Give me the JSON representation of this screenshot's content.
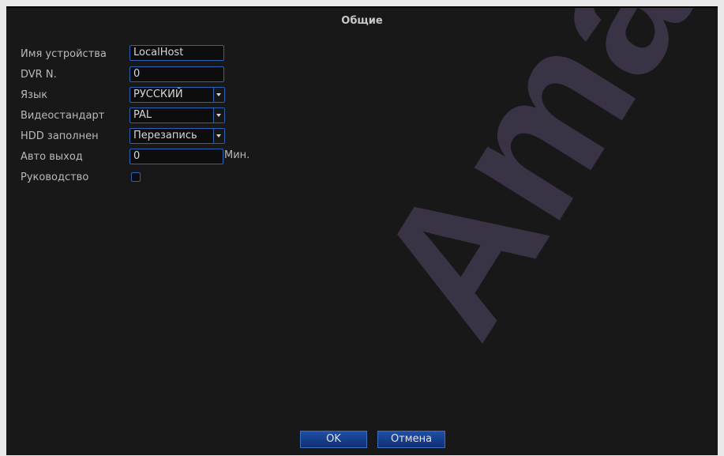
{
  "window": {
    "title": "Общие"
  },
  "form": {
    "device_name": {
      "label": "Имя устройства",
      "value": "LocalHost"
    },
    "dvr_no": {
      "label": "DVR N.",
      "value": "0"
    },
    "language": {
      "label": "Язык",
      "value": "РУССКИЙ"
    },
    "video_standard": {
      "label": "Видеостандарт",
      "value": "PAL"
    },
    "hdd_full": {
      "label": "HDD заполнен",
      "value": "Перезапись"
    },
    "auto_logout": {
      "label": "Авто выход",
      "value": "0",
      "unit": "Мин."
    },
    "guide": {
      "label": "Руководство",
      "checked": false
    }
  },
  "buttons": {
    "ok": "OK",
    "cancel": "Отмена"
  },
  "watermark": {
    "text": "Amate",
    "color": "#3a3346"
  },
  "colors": {
    "field_border": "#2b62b3",
    "button": "#1a46a0"
  }
}
